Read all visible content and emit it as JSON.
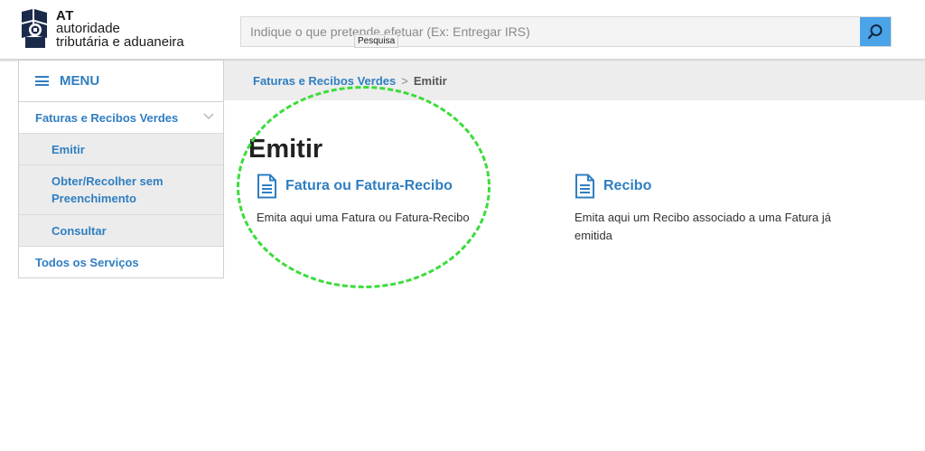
{
  "header": {
    "logo": {
      "line1": "AT",
      "line2": "autoridade",
      "line3": "tributária e aduaneira"
    },
    "search": {
      "placeholder": "Indique o que pretende efetuar (Ex: Entregar IRS)",
      "button_icon": "search-icon",
      "tooltip": "Pesquisa"
    }
  },
  "breadcrumb": {
    "parent": "Faturas e Recibos Verdes",
    "separator": ">",
    "current": "Emitir"
  },
  "sidebar": {
    "menu_label": "MENU",
    "parent_item": "Faturas e Recibos Verdes",
    "sub_items": [
      "Emitir",
      "Obter/Recolher sem Preenchimento",
      "Consultar"
    ],
    "all_services": "Todos os Serviços"
  },
  "main": {
    "title": "Emitir",
    "cards": [
      {
        "title": "Fatura ou Fatura-Recibo",
        "description": "Emita aqui uma Fatura ou Fatura-Recibo",
        "icon": "document-icon"
      },
      {
        "title": "Recibo",
        "description": "Emita aqui um Recibo associado a uma Fatura já emitida",
        "icon": "document-icon"
      }
    ]
  },
  "colors": {
    "accent": "#2f7ec1",
    "search_button": "#4ba3e8",
    "highlight": "#3bdc3b"
  }
}
